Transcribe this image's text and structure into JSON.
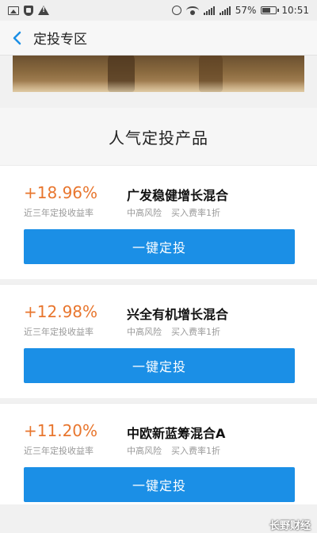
{
  "status_bar": {
    "battery": "57%",
    "time": "10:51",
    "icons": [
      "image-icon",
      "shield-icon",
      "warning-icon",
      "alarm-icon",
      "wifi-icon",
      "signal-icon",
      "battery-icon"
    ]
  },
  "nav": {
    "back_icon": "chevron-left-icon",
    "title": "定投专区"
  },
  "section": {
    "title": "人气定投产品"
  },
  "products": [
    {
      "rate": "+18.96%",
      "rate_label": "近三年定投收益率",
      "name": "广发稳健增长混合",
      "risk": "中高风险",
      "fee": "买入费率1折",
      "button": "一键定投"
    },
    {
      "rate": "+12.98%",
      "rate_label": "近三年定投收益率",
      "name": "兴全有机增长混合",
      "risk": "中高风险",
      "fee": "买入费率1折",
      "button": "一键定投"
    },
    {
      "rate": "+11.20%",
      "rate_label": "近三年定投收益率",
      "name": "中欧新蓝筹混合A",
      "risk": "中高风险",
      "fee": "买入费率1折",
      "button": "一键定投"
    }
  ],
  "watermark": "长野财经",
  "colors": {
    "accent_blue": "#1b8fe6",
    "rate_orange": "#e8762e",
    "back_blue": "#1b8fe6"
  }
}
